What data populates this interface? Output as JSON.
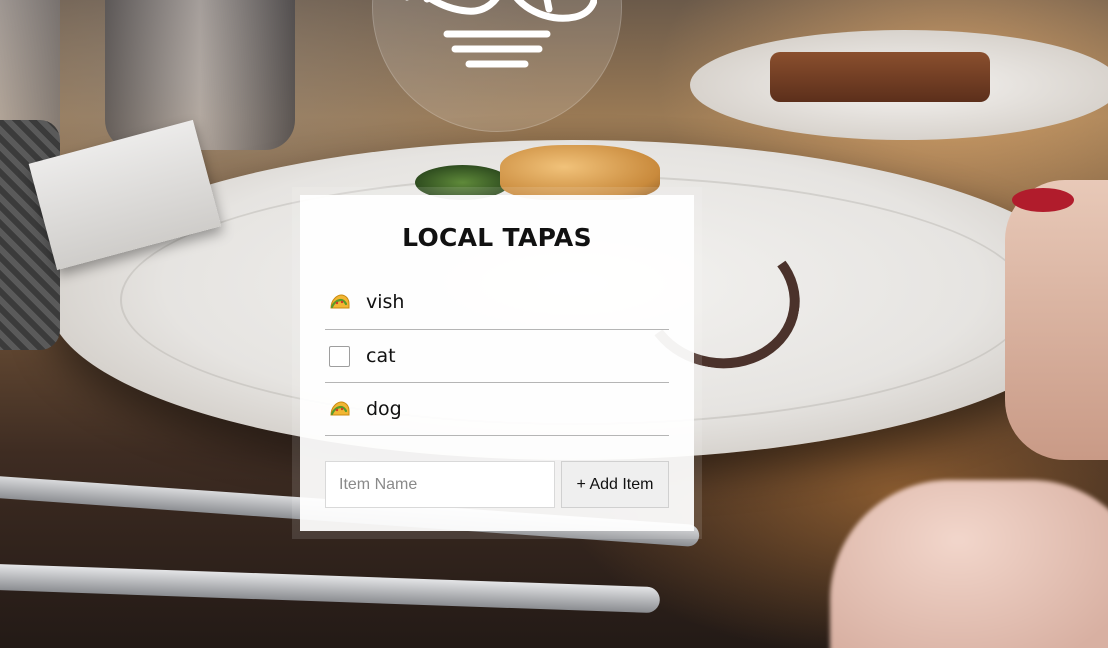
{
  "app": {
    "title": "LOCAL TAPAS"
  },
  "logo": {
    "icon": "fish-on-plate-icon"
  },
  "items": [
    {
      "label": "vish",
      "checked": true,
      "icon": "taco-icon"
    },
    {
      "label": "cat",
      "checked": false,
      "icon": "checkbox-icon"
    },
    {
      "label": "dog",
      "checked": true,
      "icon": "taco-icon"
    }
  ],
  "form": {
    "input_placeholder": "Item Name",
    "input_value": "",
    "add_button_label": "+ Add Item"
  },
  "colors": {
    "card_background": "#ffffff",
    "divider": "#b5b5b5",
    "taco_shell": "#f2b632",
    "taco_filling": "#5a9a2a"
  }
}
